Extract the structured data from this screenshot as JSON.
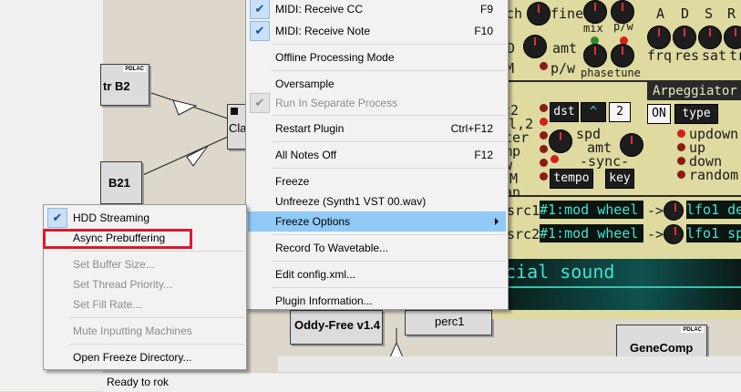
{
  "statusbar": {
    "text": "Ready to rok"
  },
  "machines": {
    "tr_b2": {
      "label": "tr B2",
      "tag": "PDLAC"
    },
    "b21": {
      "label": "B21"
    },
    "cla": {
      "label": "Cla"
    },
    "oddy": {
      "label": "Oddy-Free v1.4"
    },
    "perc": {
      "label": "perc1"
    },
    "genecomp": {
      "label": "GeneComp",
      "tag": "PDLAC"
    }
  },
  "synth": {
    "top_labels": [
      "tch",
      "fine",
      "A",
      "D",
      "S",
      "R"
    ],
    "row2_labels": [
      "D",
      "amt",
      "mix",
      "p/w",
      "frq",
      "res",
      "sat",
      "tr"
    ],
    "row3_labels": [
      "FM",
      "p/w",
      "phase",
      "tune"
    ],
    "side_labels": [
      "sc2",
      "scl,2",
      "lter",
      "amp",
      "/w",
      "FM",
      "oan"
    ],
    "dst_label": "dst",
    "num_label": "2",
    "spd_label": "spd",
    "amt_label": "amt",
    "sync_label": "-sync-",
    "tempo_label": "tempo",
    "key_label": "key",
    "arp_title": "Arpeggiator",
    "on_label": "ON",
    "type_label": "type",
    "arp_modes": [
      "updown",
      "up",
      "down",
      "random"
    ],
    "mod_rows": [
      {
        "src": "src1",
        "value": "#1:mod wheel",
        "arrow": "->",
        "dest": "lfo1 de"
      },
      {
        "src": "src2",
        "value": "#1:mod wheel",
        "arrow": "->",
        "dest": "lfo1 sp"
      }
    ],
    "lcd_text": "cial sound"
  },
  "main_menu": {
    "items": [
      {
        "label": "MIDI: Receive CC",
        "shortcut": "F9",
        "checked": true
      },
      {
        "label": "MIDI: Receive Note",
        "shortcut": "F10",
        "checked": true
      },
      {
        "label": "Offline Processing Mode"
      },
      {
        "label": "Oversample"
      },
      {
        "label": "Run In Separate Process",
        "checked": true,
        "disabled": true
      },
      {
        "label": "Restart Plugin",
        "shortcut": "Ctrl+F12"
      },
      {
        "label": "All Notes Off",
        "shortcut": "F12"
      },
      {
        "label": "Freeze"
      },
      {
        "label": "Unfreeze (Synth1 VST 00.wav)"
      },
      {
        "label": "Freeze Options",
        "submenu": true
      },
      {
        "label": "Record To Wavetable..."
      },
      {
        "label": "Edit config.xml..."
      },
      {
        "label": "Plugin Information..."
      }
    ]
  },
  "freeze_menu": {
    "items": [
      {
        "label": "HDD Streaming",
        "checked": true
      },
      {
        "label": "Async Prebuffering"
      },
      {
        "label": "Set Buffer Size...",
        "disabled": true
      },
      {
        "label": "Set Thread Priority...",
        "disabled": true
      },
      {
        "label": "Set Fill Rate...",
        "disabled": true
      },
      {
        "label": "Mute Inputting Machines",
        "disabled": true
      },
      {
        "label": "Open Freeze Directory..."
      }
    ]
  }
}
